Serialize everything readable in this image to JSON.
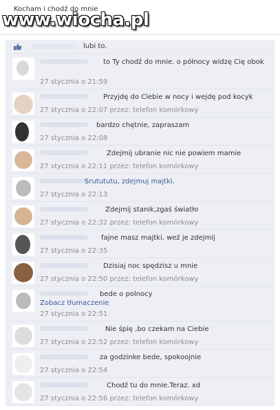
{
  "header": {
    "status_text": "Kocham i chodź do mnie",
    "watermark": "www.wiocha.pl"
  },
  "likes": {
    "text": "lubi to."
  },
  "comments": [
    {
      "text": "to Ty chodź do mnie. o północy widzę Cię obok",
      "time": "27 stycznia o 21:59",
      "via": ""
    },
    {
      "text": "Przyjdę do Ciebie w nocy i wejdę pod kocyk",
      "time": "27 stycznia o 22:07",
      "via": "przez: telefon komórkowy"
    },
    {
      "text": "bardzo chętnie, zapraszam",
      "time": "27 stycznia o 22:08",
      "via": ""
    },
    {
      "text": "Zdejmij ubranie nic nie powiem mamie",
      "time": "27 stycznia o 22:11",
      "via": "przez: telefon komórkowy"
    },
    {
      "text": "Srutututu, zdejmuj majtki.",
      "time": "27 stycznia o 22:13",
      "via": ""
    },
    {
      "text": "Zdejmij stanik,zgaś światło",
      "time": "27 stycznia o 22:32",
      "via": "przez: telefon komórkowy"
    },
    {
      "text": "fajne masz majtki, weź je zdejmij",
      "time": "27 stycznia o 22:35",
      "via": ""
    },
    {
      "text": "Dzisiaj noc spędzisz u mnie",
      "time": "27 stycznia o 22:50",
      "via": "przez: telefon komórkowy"
    },
    {
      "text": "bede o polnocy",
      "translate": "Zobacz tłumaczenie",
      "time": "27 stycznia o 22:51",
      "via": ""
    },
    {
      "text": "Nie śpię ,bo czekam na Ciebie",
      "time": "27 stycznia o 22:52",
      "via": "przez: telefon komórkowy"
    },
    {
      "text": "za godzinke bede, spokoojnie",
      "time": "27 stycznia o 22:54",
      "via": ""
    },
    {
      "text": "Chodź tu do mnie.Teraz. xd",
      "time": "27 stycznia o 22:56",
      "via": "przez: telefon komórkowy"
    }
  ],
  "colors": {
    "comment_bg": "#edeff4",
    "link_blue": "#3b5998",
    "meta_gray": "#8c8c8c",
    "text_dark": "#333333"
  },
  "icons": {
    "likes": "thumbs-up-icon"
  }
}
